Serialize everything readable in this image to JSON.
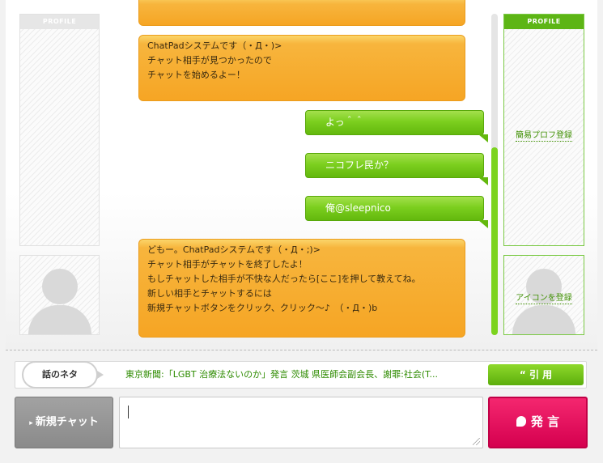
{
  "left_panel": {
    "header": "PROFILE"
  },
  "right_panel": {
    "header": "PROFILE",
    "profile_link": "簡易プロフ登録",
    "icon_link": "アイコンを登録"
  },
  "messages": [
    {
      "sender": "system",
      "lines": [
        "ChatPadシステムです（・Д・)>",
        "チャット相手が見つかったので",
        "チャットを始めるよー！"
      ]
    },
    {
      "sender": "me",
      "text": "よっ＾＾"
    },
    {
      "sender": "me",
      "text": "ニコフレ民か？"
    },
    {
      "sender": "me",
      "text": "俺@sleepnico"
    },
    {
      "sender": "system",
      "lines": [
        "どもー。ChatPadシステムです（・Д・;)>",
        "チャット相手がチャットを終了したよ！",
        "もしチャットした相手が不快な人だったら[ここ]を押して教えてね。",
        "新しい相手とチャットするには",
        "新規チャットボタンをクリック、クリック～♪　（・Д・)b"
      ]
    }
  ],
  "topic": {
    "label": "話のネタ",
    "text": "東京新聞:「LGBT 治療法ないのか」発言 茨城 県医師会副会長、謝罪:社会(T...",
    "quote_label": "引 用"
  },
  "footer": {
    "new_chat_label": "新規チャット",
    "send_label": "発 言",
    "input_value": ""
  },
  "colors": {
    "system_bubble": "#f6a524",
    "my_bubble": "#7ccf1f",
    "accent_green": "#5db515",
    "send_button": "#e4005a",
    "new_chat_button": "#999999"
  }
}
